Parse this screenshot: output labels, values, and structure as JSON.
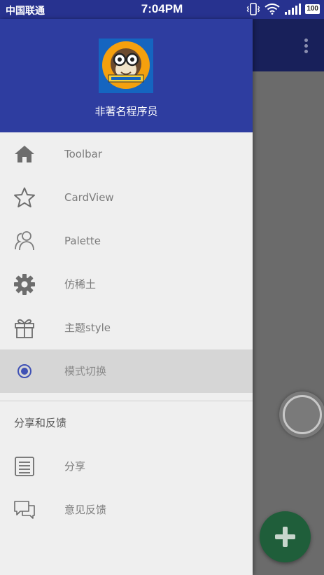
{
  "status_bar": {
    "carrier": "中国联通",
    "time": "7:04PM",
    "battery": "100"
  },
  "drawer": {
    "header": {
      "name": "非著名程序员",
      "background": "#2e3da0"
    },
    "menu_items": [
      {
        "label": "Toolbar",
        "icon": "home-icon"
      },
      {
        "label": "CardView",
        "icon": "star-outline-icon"
      },
      {
        "label": "Palette",
        "icon": "people-icon"
      },
      {
        "label": "仿稀土",
        "icon": "gear-icon"
      },
      {
        "label": "主题style",
        "icon": "gift-icon"
      },
      {
        "label": "模式切换",
        "icon": "radio-selected-icon",
        "selected": true
      }
    ],
    "section_title": "分享和反馈",
    "section_items": [
      {
        "label": "分享",
        "icon": "list-document-icon"
      },
      {
        "label": "意见反馈",
        "icon": "chat-bubbles-icon"
      }
    ]
  },
  "colors": {
    "status_bar": "#27328f",
    "accent": "#3f51b5",
    "fab": "#1f5e3a"
  }
}
